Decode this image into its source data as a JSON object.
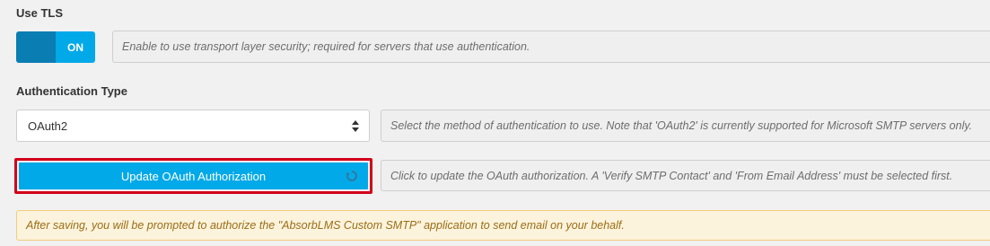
{
  "tls": {
    "label": "Use TLS",
    "toggle_state": "ON",
    "help": "Enable to use transport layer security; required for servers that use authentication."
  },
  "auth_type": {
    "label": "Authentication Type",
    "selected": "OAuth2",
    "help": "Select the method of authentication to use. Note that 'OAuth2' is currently supported for Microsoft SMTP servers only."
  },
  "oauth": {
    "button_label": "Update OAuth Authorization",
    "help": "Click to update the OAuth authorization. A 'Verify SMTP Contact' and 'From Email Address' must be selected first."
  },
  "notice": {
    "text": "After saving, you will be prompted to authorize the \"AbsorbLMS Custom SMTP\" application to send email on your behalf."
  },
  "colors": {
    "accent": "#02a9e8",
    "toggle_dark": "#0a7db3",
    "highlight_border": "#d2001b",
    "notice_bg": "#fcf3dd"
  },
  "icons": {
    "refresh": "refresh-icon",
    "select_arrows": "updown-arrows-icon"
  }
}
